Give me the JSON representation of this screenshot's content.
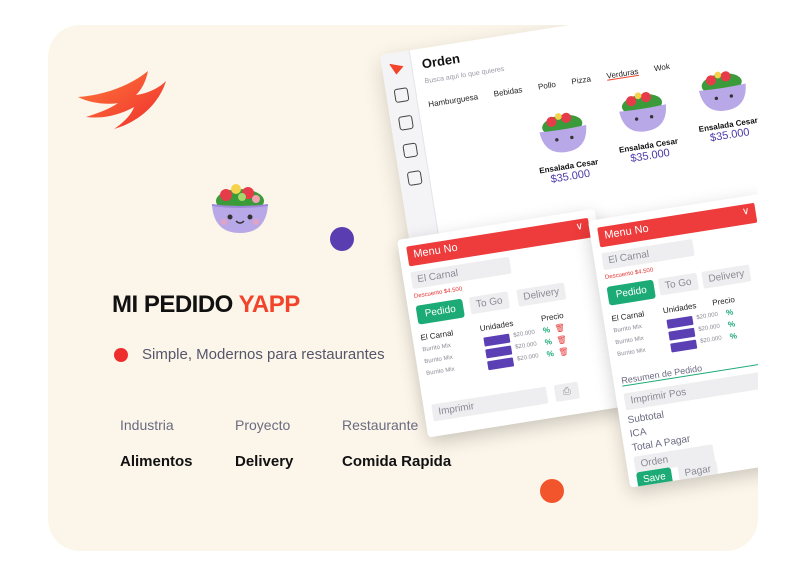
{
  "brand": {
    "headline_main": "MI PEDIDO",
    "headline_accent": "YAPP",
    "tagline": "Simple, Modernos para restaurantes"
  },
  "meta": [
    {
      "label": "Industria",
      "value": "Alimentos"
    },
    {
      "label": "Proyecto",
      "value": "Delivery"
    },
    {
      "label": "Restaurante",
      "value": "Comida Rapida"
    }
  ],
  "app": {
    "title": "Orden",
    "search_placeholder": "Busca aqui lo que quieres",
    "categories": [
      "Hamburguesa",
      "Bebidas",
      "Pollo",
      "Pizza",
      "Verduras",
      "Wok"
    ],
    "products": [
      {
        "name": "Ensalada Cesar",
        "price": "$35.000"
      },
      {
        "name": "Ensalada Cesar",
        "price": "$35.000"
      },
      {
        "name": "Ensalada Cesar",
        "price": "$35.000"
      }
    ],
    "panel": {
      "menu_label": "Menu No",
      "restaurant": "El Carnal",
      "discount": "Descuento $4.500",
      "order_types": [
        "Pedido",
        "To Go",
        "Delivery"
      ],
      "col_headers": [
        "El Carnal",
        "Unidades",
        "Precio"
      ],
      "items": [
        {
          "name": "Burrito Mix",
          "price": "$20.000"
        },
        {
          "name": "Burrito Mix",
          "price": "$20.000"
        },
        {
          "name": "Burrito Mix",
          "price": "$20.000"
        }
      ],
      "print_label": "Imprimir",
      "summary_label": "Resumen de Pedido",
      "print_pos_label": "Imprimir Pos",
      "totals": [
        "Subtotal",
        "ICA",
        "Total A  Pagar"
      ],
      "order_label": "Orden",
      "save_label": "Save",
      "pay_label": "Pagar"
    }
  },
  "colors": {
    "accent": "#f2442a",
    "purple": "#5a3db0",
    "green": "#1cab76",
    "background": "#fcf6ea"
  }
}
